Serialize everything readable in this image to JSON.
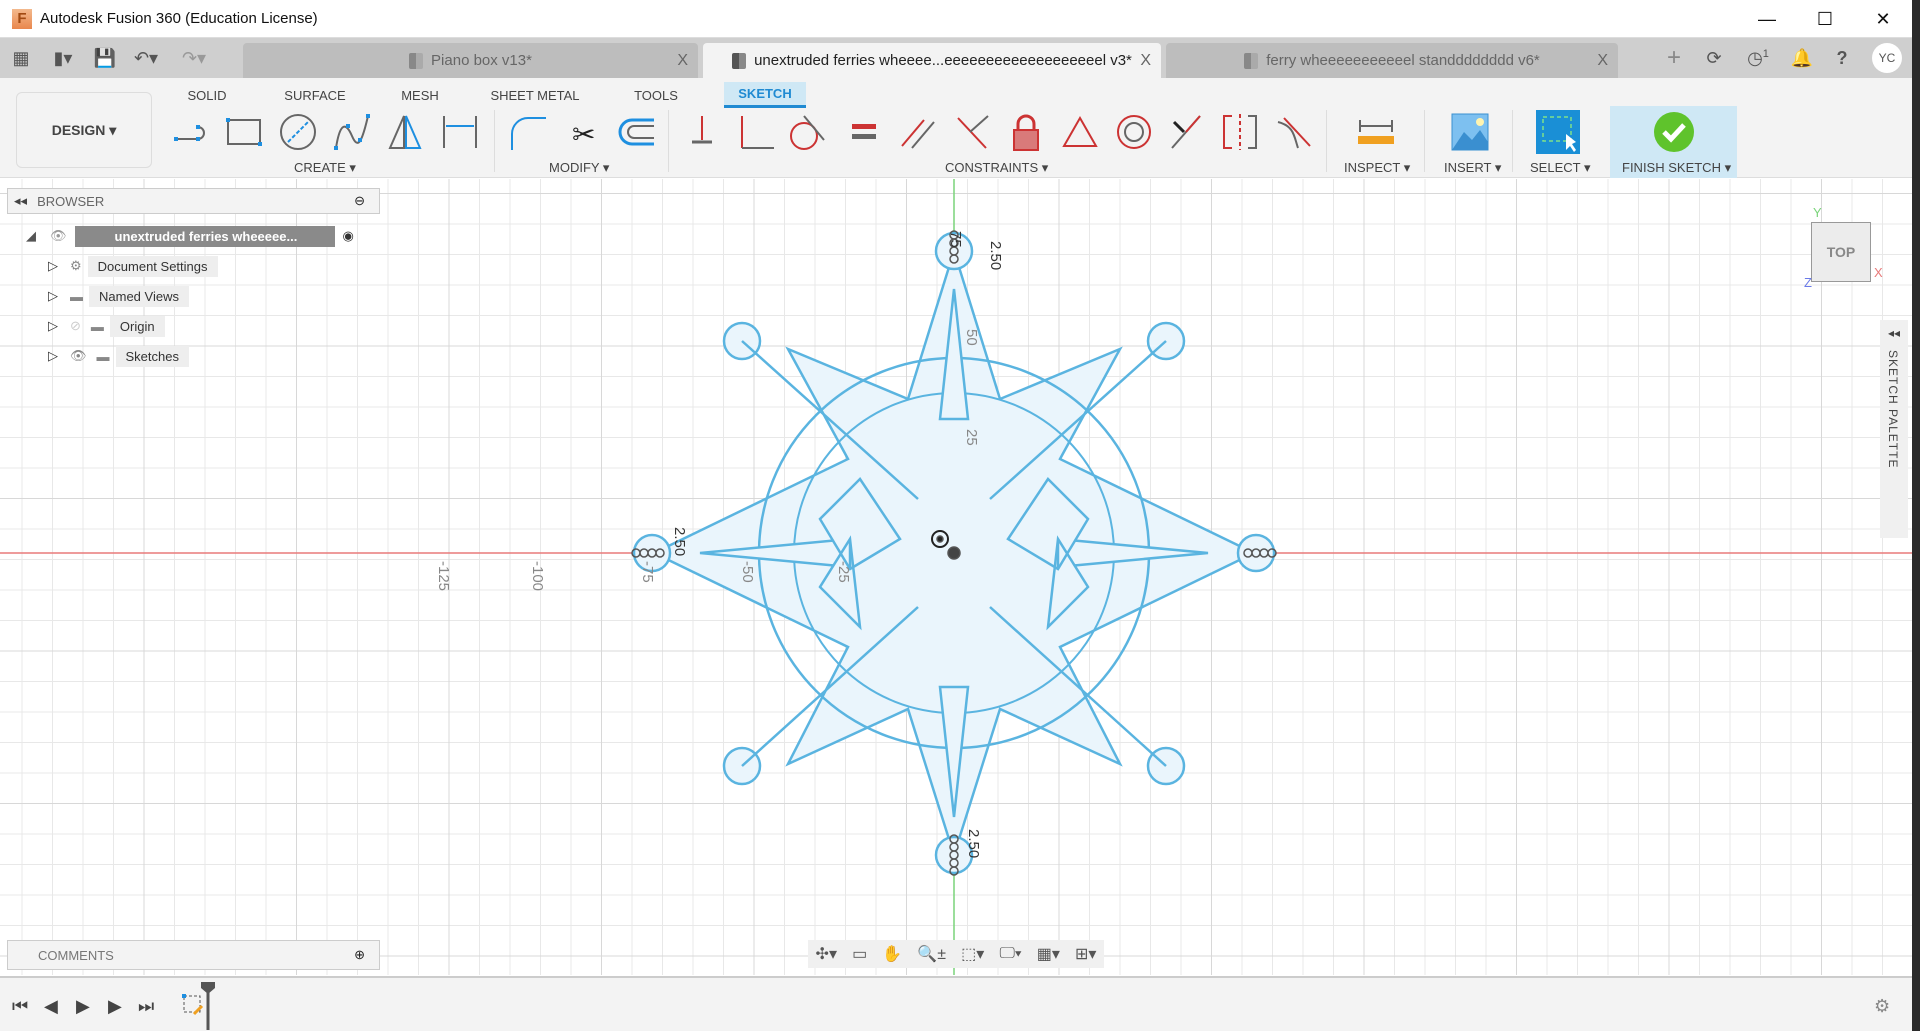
{
  "window": {
    "title": "Autodesk Fusion 360 (Education License)",
    "app_icon_letter": "F",
    "minimize": "—",
    "maximize": "☐",
    "close": "✕"
  },
  "quick_access": {
    "apps": "▦",
    "file": "▮▾",
    "save": "💾",
    "undo": "↶▾",
    "redo": "↷▾"
  },
  "doc_tabs": [
    {
      "label": "Piano box v13*",
      "active": false
    },
    {
      "label": "unextruded ferries wheeee...eeeeeeeeeeeeeeeeeeel v3*",
      "active": true
    },
    {
      "label": "ferry wheeeeeeeeeeel standddddddd v6*",
      "active": false
    }
  ],
  "tab_close": "X",
  "tab_right": {
    "new_tab": "+",
    "job_status": "⟳",
    "clock": "◷",
    "clock_count": "1",
    "notifications": "🔔",
    "help": "?",
    "avatar": "YC"
  },
  "ribbon": {
    "workspace": "DESIGN ▾",
    "tabs": [
      "SOLID",
      "SURFACE",
      "MESH",
      "SHEET METAL",
      "TOOLS",
      "SKETCH"
    ],
    "active_tab": "SKETCH",
    "groups": {
      "create": "CREATE ▾",
      "modify": "MODIFY ▾",
      "constraints": "CONSTRAINTS ▾",
      "inspect": "INSPECT ▾",
      "insert": "INSERT ▾",
      "select": "SELECT ▾",
      "finish": "FINISH SKETCH ▾"
    }
  },
  "browser": {
    "title": "BROWSER",
    "root": "unextruded ferries wheeeee...",
    "items": [
      "Document Settings",
      "Named Views",
      "Origin",
      "Sketches"
    ]
  },
  "comments": {
    "title": "COMMENTS"
  },
  "canvas": {
    "x_ticks": [
      "-125",
      "-100",
      "-75",
      "-50",
      "-25"
    ],
    "y_ticks": [
      "50",
      "25"
    ],
    "dimension_labels": [
      "2.50",
      "2.50",
      "2.50",
      "75"
    ],
    "viewcube": "TOP",
    "axes": {
      "x": "X",
      "y": "Y",
      "z": "Z"
    },
    "sketch_palette": "SKETCH PALETTE",
    "colors": {
      "sketch_line": "#5ab4e0",
      "sketch_fill": "#eaf5fc",
      "x_axis": "#e87a7a",
      "y_axis": "#7ad47a"
    }
  },
  "timeline": {
    "first": "⏮",
    "prev": "◀",
    "play": "▶",
    "next": "▶",
    "last": "⏭",
    "settings": "⚙"
  }
}
